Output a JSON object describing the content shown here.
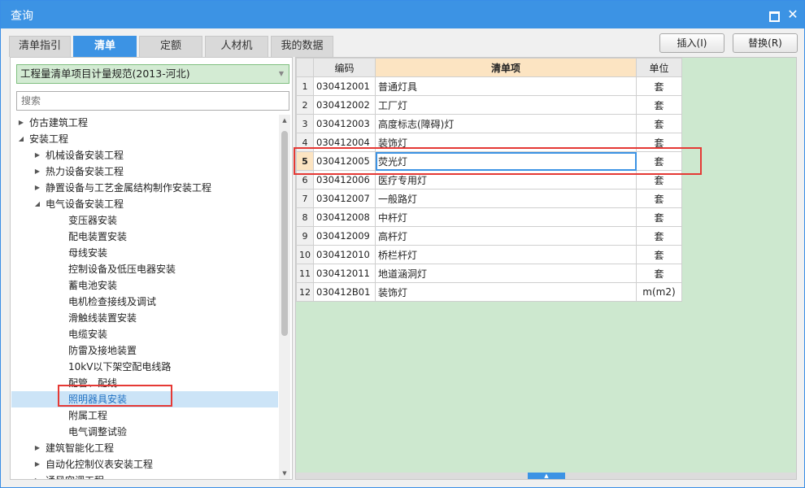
{
  "window": {
    "title": "查询"
  },
  "tabs": [
    {
      "label": "清单指引",
      "active": false
    },
    {
      "label": "清单",
      "active": true
    },
    {
      "label": "定额",
      "active": false
    },
    {
      "label": "人材机",
      "active": false
    },
    {
      "label": "我的数据",
      "active": false
    }
  ],
  "actions": {
    "insert_label": "插入(I)",
    "replace_label": "替换(R)"
  },
  "left": {
    "spec_select": "工程量清单项目计量规范(2013-河北)",
    "search_placeholder": "搜索",
    "tree": [
      {
        "label": "仿古建筑工程",
        "level": 0,
        "toggle": "collapsed"
      },
      {
        "label": "安装工程",
        "level": 0,
        "toggle": "expanded"
      },
      {
        "label": "机械设备安装工程",
        "level": 1,
        "toggle": "collapsed"
      },
      {
        "label": "热力设备安装工程",
        "level": 1,
        "toggle": "collapsed"
      },
      {
        "label": "静置设备与工艺金属结构制作安装工程",
        "level": 1,
        "toggle": "collapsed"
      },
      {
        "label": "电气设备安装工程",
        "level": 1,
        "toggle": "expanded"
      },
      {
        "label": "变压器安装",
        "level": 2,
        "toggle": "none"
      },
      {
        "label": "配电装置安装",
        "level": 2,
        "toggle": "none"
      },
      {
        "label": "母线安装",
        "level": 2,
        "toggle": "none"
      },
      {
        "label": "控制设备及低压电器安装",
        "level": 2,
        "toggle": "none"
      },
      {
        "label": "蓄电池安装",
        "level": 2,
        "toggle": "none"
      },
      {
        "label": "电机检查接线及调试",
        "level": 2,
        "toggle": "none"
      },
      {
        "label": "滑触线装置安装",
        "level": 2,
        "toggle": "none"
      },
      {
        "label": "电缆安装",
        "level": 2,
        "toggle": "none"
      },
      {
        "label": "防雷及接地装置",
        "level": 2,
        "toggle": "none"
      },
      {
        "label": "10kV以下架空配电线路",
        "level": 2,
        "toggle": "none"
      },
      {
        "label": "配管、配线",
        "level": 2,
        "toggle": "none"
      },
      {
        "label": "照明器具安装",
        "level": 2,
        "toggle": "none",
        "selected": true
      },
      {
        "label": "附属工程",
        "level": 2,
        "toggle": "none"
      },
      {
        "label": "电气调整试验",
        "level": 2,
        "toggle": "none"
      },
      {
        "label": "建筑智能化工程",
        "level": 1,
        "toggle": "collapsed"
      },
      {
        "label": "自动化控制仪表安装工程",
        "level": 1,
        "toggle": "collapsed"
      },
      {
        "label": "通风空调工程",
        "level": 1,
        "toggle": "collapsed"
      }
    ]
  },
  "grid": {
    "headers": {
      "code": "编码",
      "name": "清单项",
      "unit": "单位"
    },
    "rows": [
      {
        "no": "1",
        "code": "030412001",
        "name": "普通灯具",
        "unit": "套"
      },
      {
        "no": "2",
        "code": "030412002",
        "name": "工厂灯",
        "unit": "套"
      },
      {
        "no": "3",
        "code": "030412003",
        "name": "高度标志(障碍)灯",
        "unit": "套"
      },
      {
        "no": "4",
        "code": "030412004",
        "name": "装饰灯",
        "unit": "套"
      },
      {
        "no": "5",
        "code": "030412005",
        "name": "荧光灯",
        "unit": "套",
        "current": true
      },
      {
        "no": "6",
        "code": "030412006",
        "name": "医疗专用灯",
        "unit": "套"
      },
      {
        "no": "7",
        "code": "030412007",
        "name": "一般路灯",
        "unit": "套"
      },
      {
        "no": "8",
        "code": "030412008",
        "name": "中杆灯",
        "unit": "套"
      },
      {
        "no": "9",
        "code": "030412009",
        "name": "高杆灯",
        "unit": "套"
      },
      {
        "no": "10",
        "code": "030412010",
        "name": "桥栏杆灯",
        "unit": "套"
      },
      {
        "no": "11",
        "code": "030412011",
        "name": "地道涵洞灯",
        "unit": "套"
      },
      {
        "no": "12",
        "code": "030412B01",
        "name": "装饰灯",
        "unit": "m(m2)"
      }
    ]
  },
  "colors": {
    "accent": "#3c93e4",
    "highlight_box": "#e53935",
    "grid_bg": "#cde8cf"
  }
}
